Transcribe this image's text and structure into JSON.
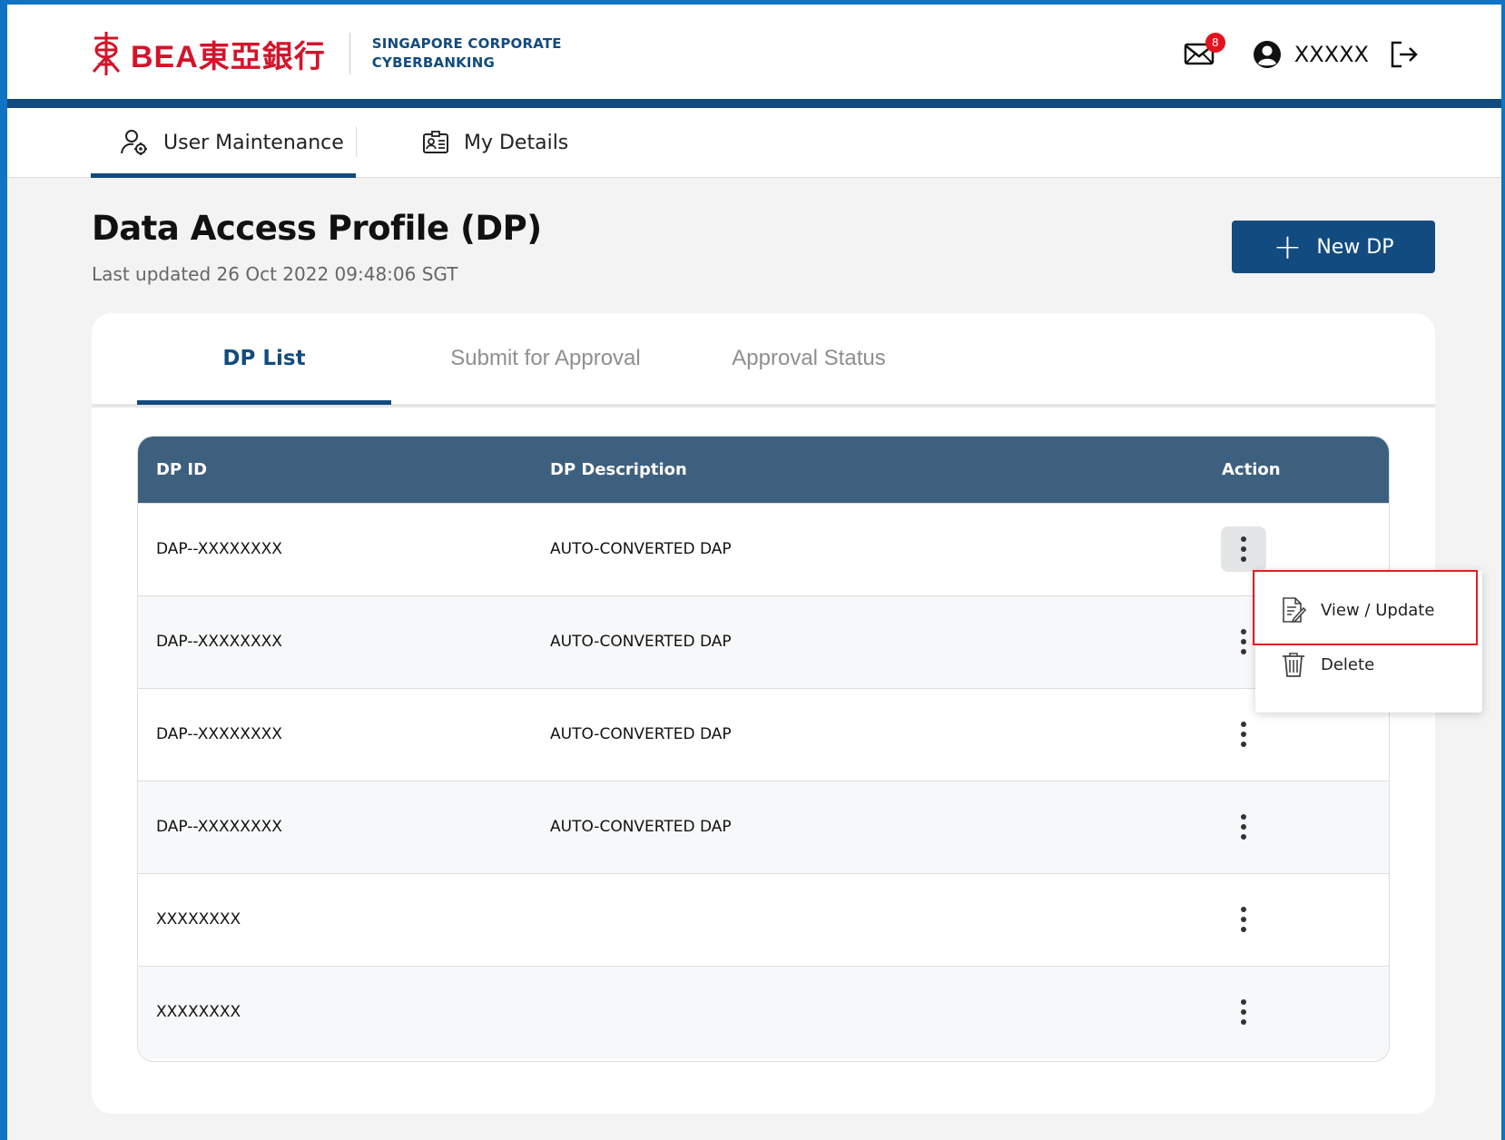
{
  "header": {
    "brand": "BEA東亞銀行",
    "subtitle_line1": "SINGAPORE CORPORATE",
    "subtitle_line2": "CYBERBANKING",
    "mail_badge": "8",
    "username": "XXXXX"
  },
  "nav": {
    "items": [
      {
        "label": "User Maintenance",
        "active": true
      },
      {
        "label": "My Details",
        "active": false
      }
    ]
  },
  "page": {
    "title": "Data Access Profile (DP)",
    "last_updated": "Last updated 26 Oct 2022 09:48:06 SGT",
    "new_button": "New DP"
  },
  "tabs": [
    {
      "label": "DP List",
      "active": true
    },
    {
      "label": "Submit for Approval",
      "active": false
    },
    {
      "label": "Approval Status",
      "active": false
    }
  ],
  "table": {
    "columns": [
      "DP ID",
      "DP Description",
      "Action"
    ],
    "rows": [
      {
        "id": "DAP--XXXXXXXX",
        "description": "AUTO-CONVERTED DAP"
      },
      {
        "id": "DAP--XXXXXXXX",
        "description": "AUTO-CONVERTED DAP"
      },
      {
        "id": "DAP--XXXXXXXX",
        "description": "AUTO-CONVERTED DAP"
      },
      {
        "id": "DAP--XXXXXXXX",
        "description": "AUTO-CONVERTED DAP"
      },
      {
        "id": "XXXXXXXX",
        "description": ""
      },
      {
        "id": "XXXXXXXX",
        "description": ""
      }
    ]
  },
  "action_menu": {
    "items": [
      {
        "label": "View / Update",
        "icon": "document-edit-icon"
      },
      {
        "label": "Delete",
        "icon": "trash-icon"
      }
    ]
  },
  "colors": {
    "brand_red": "#d3142b",
    "navy": "#124b7f",
    "table_header": "#3e607f",
    "highlight": "#e02020"
  }
}
